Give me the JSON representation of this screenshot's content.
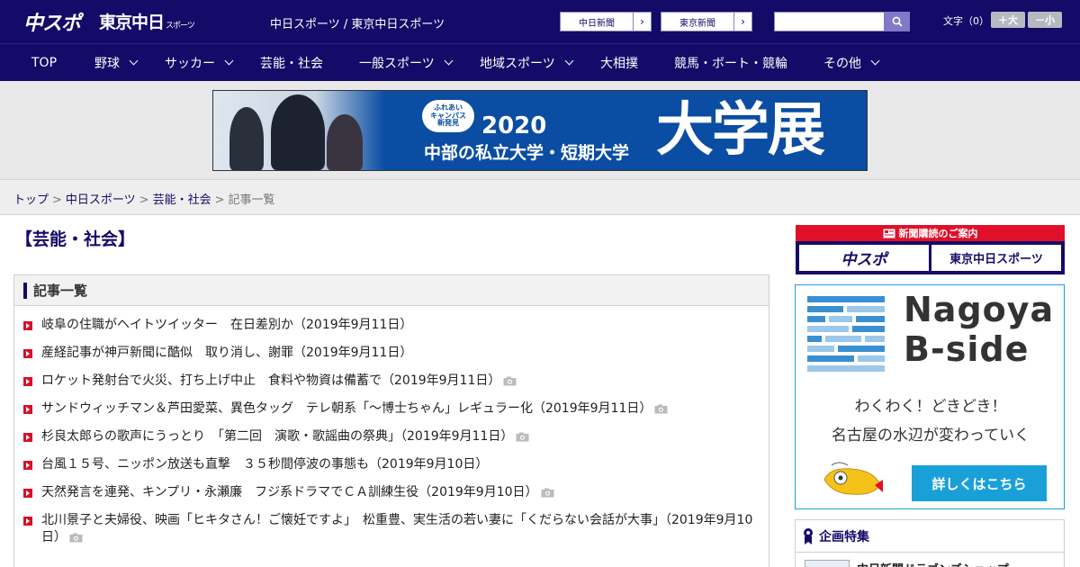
{
  "header": {
    "logo_chuspo": "中スポ",
    "logo_tokyo": "東京中日",
    "logo_tokyo_small": "スポーツ",
    "site_name": "中日スポーツ / 東京中日スポーツ",
    "ext_links": [
      {
        "label": "中日新聞"
      },
      {
        "label": "東京新聞"
      }
    ],
    "search_placeholder": "",
    "font_size_label": "文字（0）",
    "font_bigger": "＋大",
    "font_smaller": "－小"
  },
  "nav": {
    "items": [
      {
        "label": "TOP",
        "dropdown": false
      },
      {
        "label": "野球",
        "dropdown": true
      },
      {
        "label": "サッカー",
        "dropdown": true
      },
      {
        "label": "芸能・社会",
        "dropdown": false
      },
      {
        "label": "一般スポーツ",
        "dropdown": true
      },
      {
        "label": "地域スポーツ",
        "dropdown": true
      },
      {
        "label": "大相撲",
        "dropdown": false
      },
      {
        "label": "競馬・ボート・競輪",
        "dropdown": false
      },
      {
        "label": "その他",
        "dropdown": true
      }
    ]
  },
  "banner": {
    "badge_lines": [
      "ふれあい",
      "キャンパス",
      "新発見"
    ],
    "year": "2020",
    "subtitle": "中部の私立大学・短期大学",
    "big_text": "大学展"
  },
  "breadcrumb": {
    "items": [
      {
        "label": "トップ",
        "link": true
      },
      {
        "label": "中日スポーツ",
        "link": true
      },
      {
        "label": "芸能・社会",
        "link": true
      },
      {
        "label": "記事一覧",
        "link": false
      }
    ],
    "separator": ">"
  },
  "main": {
    "page_title": "【芸能・社会】",
    "list_title": "記事一覧",
    "articles": [
      {
        "title": "岐阜の住職がヘイトツイッター　在日差別か（2019年9月11日）",
        "photo": false
      },
      {
        "title": "産経記事が神戸新聞に酷似　取り消し、謝罪（2019年9月11日）",
        "photo": false
      },
      {
        "title": "ロケット発射台で火災、打ち上げ中止　食料や物資は備蓄で（2019年9月11日）",
        "photo": true
      },
      {
        "title": "サンドウィッチマン＆芦田愛菜、異色タッグ　テレ朝系「～博士ちゃん」レギュラー化（2019年9月11日）",
        "photo": true
      },
      {
        "title": "杉良太郎らの歌声にうっとり　「第二回　演歌・歌謡曲の祭典」（2019年9月11日）",
        "photo": true
      },
      {
        "title": "台風１５号、ニッポン放送も直撃　３５秒間停波の事態も（2019年9月10日）",
        "photo": false
      },
      {
        "title": "天然発言を連発、キンプリ・永瀬廉　フジ系ドラマでＣＡ訓練生役（2019年9月10日）",
        "photo": true
      },
      {
        "title": "北川景子と夫婦役、映画「ヒキタさん！ご懐妊ですよ」　松重豊、実生活の若い妻に「くだらない会話が大事」（2019年9月10日）",
        "photo": true
      }
    ]
  },
  "sidebar": {
    "subscription_title": "新聞購読のご案内",
    "subscription_buttons": [
      {
        "label": "中スポ"
      },
      {
        "label": "東京中日スポーツ"
      }
    ],
    "nagoya": {
      "title_line1": "Nagoya",
      "title_line2": "B-side",
      "tagline1": "わくわく！どきどき！",
      "tagline2": "名古屋の水辺が変わっていく",
      "button": "詳しくはこちら"
    },
    "feature": {
      "title": "企画特集",
      "item": "中日新聞ドラゴンズショップ"
    }
  },
  "colors": {
    "navy": "#140a68",
    "red": "#d6102a",
    "light_blue": "#1aa0d8",
    "banner_blue": "#0a4da2"
  }
}
